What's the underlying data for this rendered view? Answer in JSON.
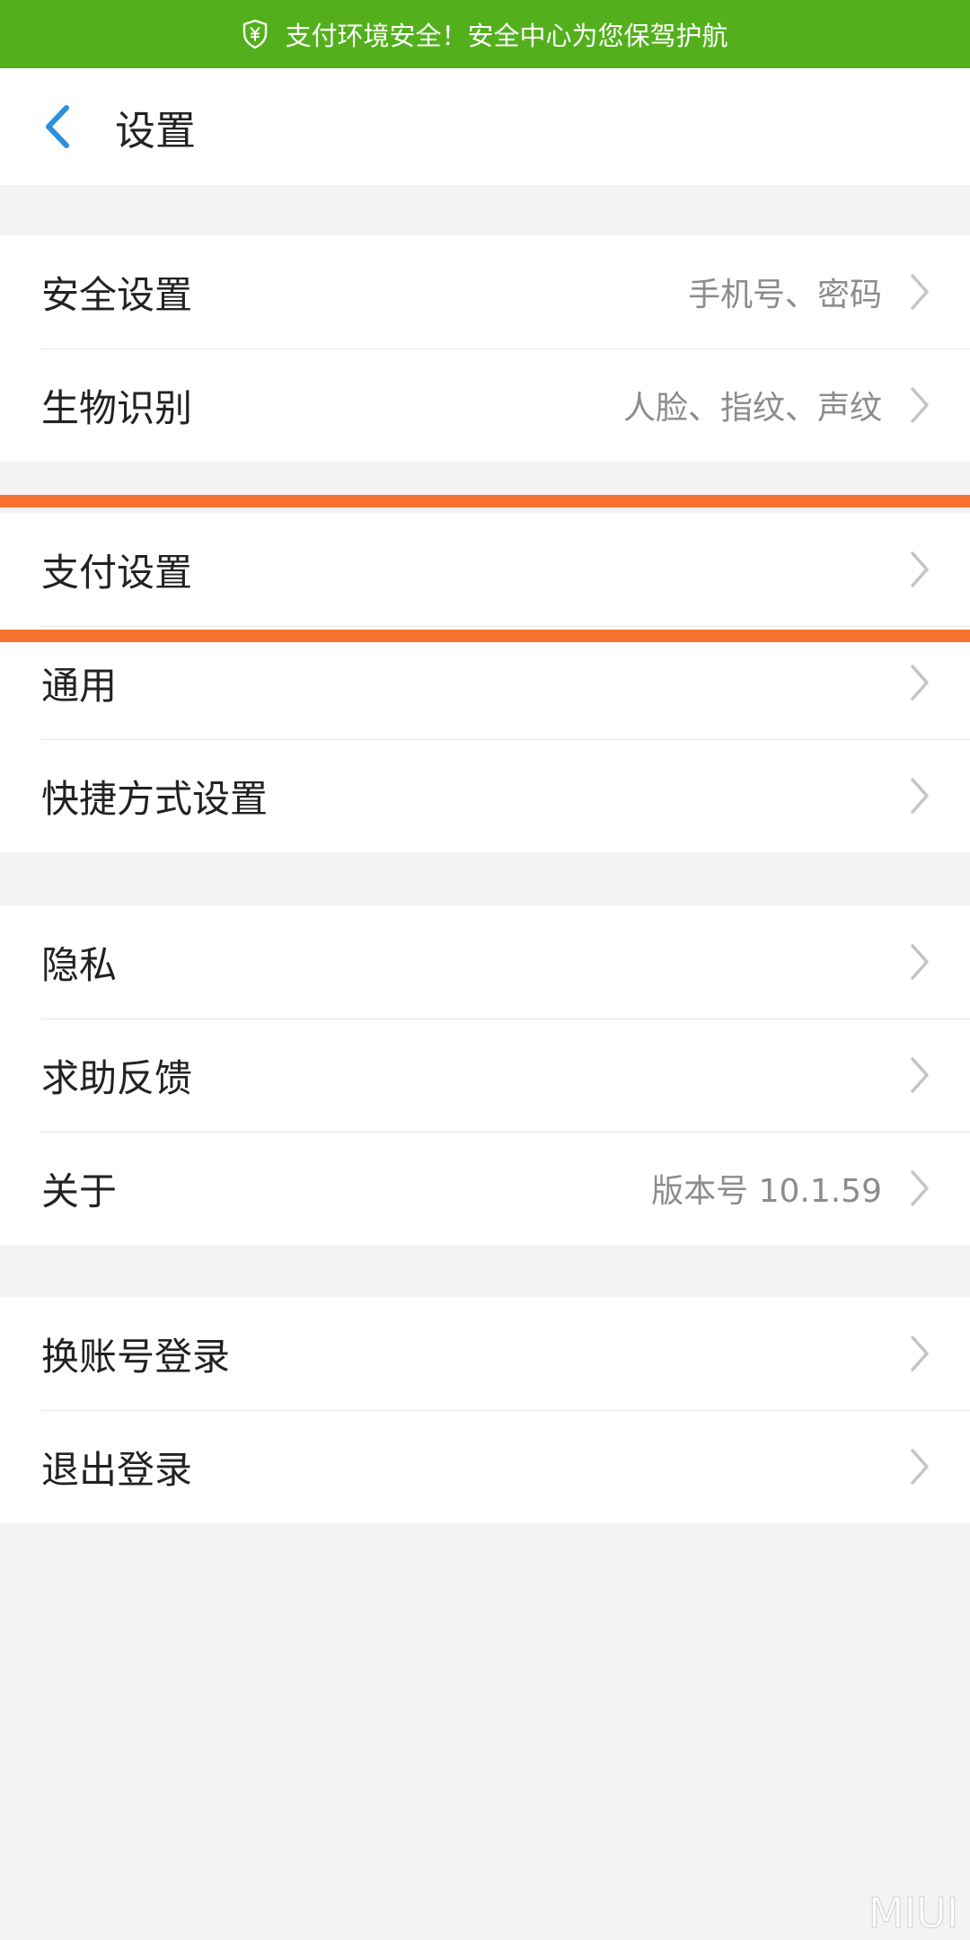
{
  "banner": {
    "text": "支付环境安全！安全中心为您保驾护航",
    "color": "#53b01c"
  },
  "header": {
    "title": "设置",
    "back_icon": "chevron-left-icon",
    "accent_color": "#2e8fdc"
  },
  "groups": [
    {
      "items": [
        {
          "label": "安全设置",
          "value": "手机号、密码"
        },
        {
          "label": "生物识别",
          "value": "人脸、指纹、声纹"
        }
      ]
    },
    {
      "items": [
        {
          "label": "支付设置",
          "value": ""
        },
        {
          "label": "通用",
          "value": ""
        },
        {
          "label": "快捷方式设置",
          "value": ""
        }
      ]
    },
    {
      "items": [
        {
          "label": "隐私",
          "value": ""
        },
        {
          "label": "求助反馈",
          "value": ""
        },
        {
          "label": "关于",
          "value": "版本号 10.1.59"
        }
      ]
    },
    {
      "items": [
        {
          "label": "换账号登录",
          "value": ""
        },
        {
          "label": "退出登录",
          "value": ""
        }
      ]
    }
  ],
  "highlight": {
    "color": "#f57230"
  },
  "watermark": {
    "text": "MIUI"
  }
}
